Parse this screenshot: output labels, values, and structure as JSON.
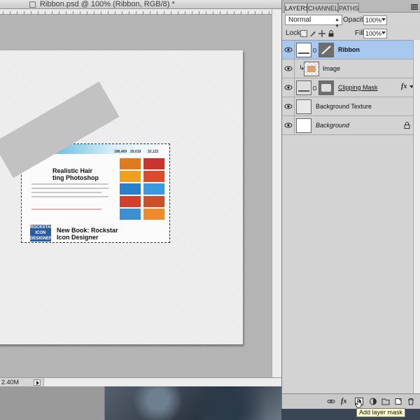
{
  "document": {
    "title": "Ribbon.psd @ 100% (Ribbon, RGB/8) *",
    "doc_size": "2.40M",
    "thumbnail": {
      "stats": [
        "198,469",
        "29,019",
        "32,123"
      ],
      "headline": "Realistic Hair\nting Photoshop",
      "book_title": "New Book: Rockstar\nIcon Designer",
      "book_cover": "ROCKSTAR\nICON\nDESIGNER",
      "tile_colors": [
        "#e07a1f",
        "#c8352c",
        "#f0a020",
        "#d94b2a",
        "#2a7fc9",
        "#3a9ae0",
        "#d3402e",
        "#c9502a",
        "#3c8fd0",
        "#f08b2c"
      ]
    }
  },
  "layers_panel": {
    "tabs": [
      {
        "label": "LAYERS",
        "active": true
      },
      {
        "label": "CHANNELS",
        "active": false
      },
      {
        "label": "PATHS",
        "active": false
      }
    ],
    "blend_mode": "Normal",
    "opacity_label": "Opacity:",
    "opacity_value": "100%",
    "lock_label": "Lock:",
    "fill_label": "Fill:",
    "fill_value": "100%",
    "layers": [
      {
        "name": "Ribbon",
        "selected": true,
        "style": "bold",
        "has_mask": true
      },
      {
        "name": "Image",
        "selected": false,
        "style": "",
        "clipped": true
      },
      {
        "name": "Clipping Mask",
        "selected": false,
        "style": "underline",
        "has_mask": true,
        "has_fx": true
      },
      {
        "name": "Background Texture",
        "selected": false,
        "style": ""
      },
      {
        "name": "Background",
        "selected": false,
        "style": "italic",
        "locked": true
      }
    ],
    "fx_label": "fx",
    "tooltip": "Add layer mask"
  },
  "colors": {
    "selected_layer": "#a9c8f0",
    "panel_bg": "#d3d3d3",
    "canvas_bg": "#b4b4b4"
  }
}
